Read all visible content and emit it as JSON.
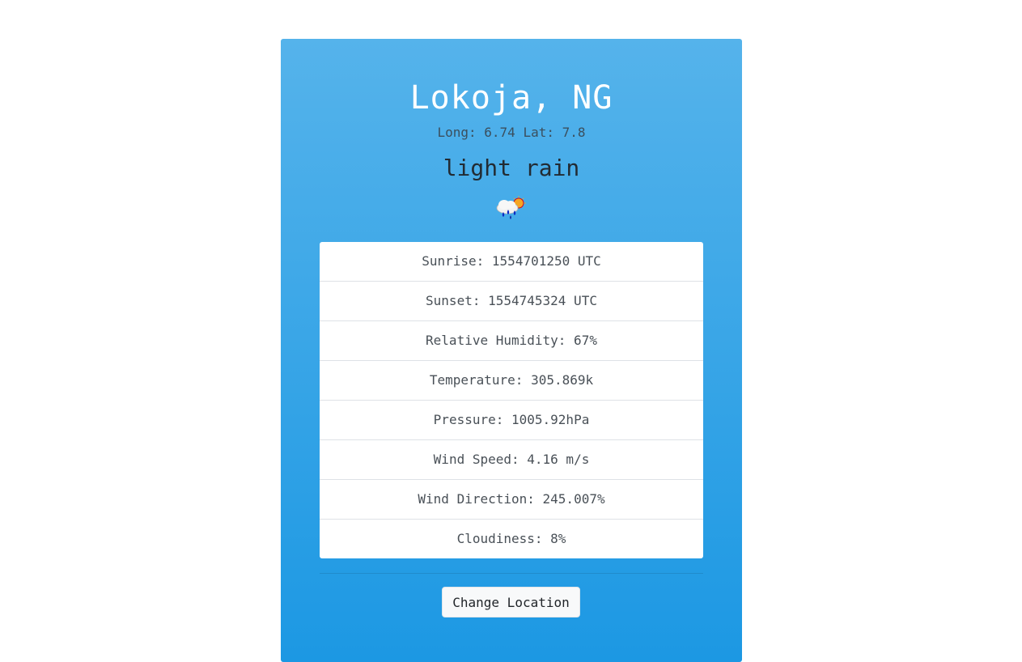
{
  "location": {
    "title": "Lokoja, NG",
    "coords": "Long: 6.74 Lat: 7.8",
    "description": "light rain",
    "icon": "rain-cloud-sun-icon"
  },
  "details": [
    {
      "label": "Sunrise: 1554701250 UTC"
    },
    {
      "label": "Sunset: 1554745324 UTC"
    },
    {
      "label": "Relative Humidity: 67%"
    },
    {
      "label": "Temperature: 305.869k"
    },
    {
      "label": "Pressure: 1005.92hPa"
    },
    {
      "label": "Wind Speed: 4.16 m/s"
    },
    {
      "label": "Wind Direction: 245.007%"
    },
    {
      "label": "Cloudiness: 8%"
    }
  ],
  "actions": {
    "change_location_label": "Change Location"
  },
  "colors": {
    "card_top": "#55b3eb",
    "card_bottom": "#1c98e3",
    "title_text": "#ffffff"
  }
}
